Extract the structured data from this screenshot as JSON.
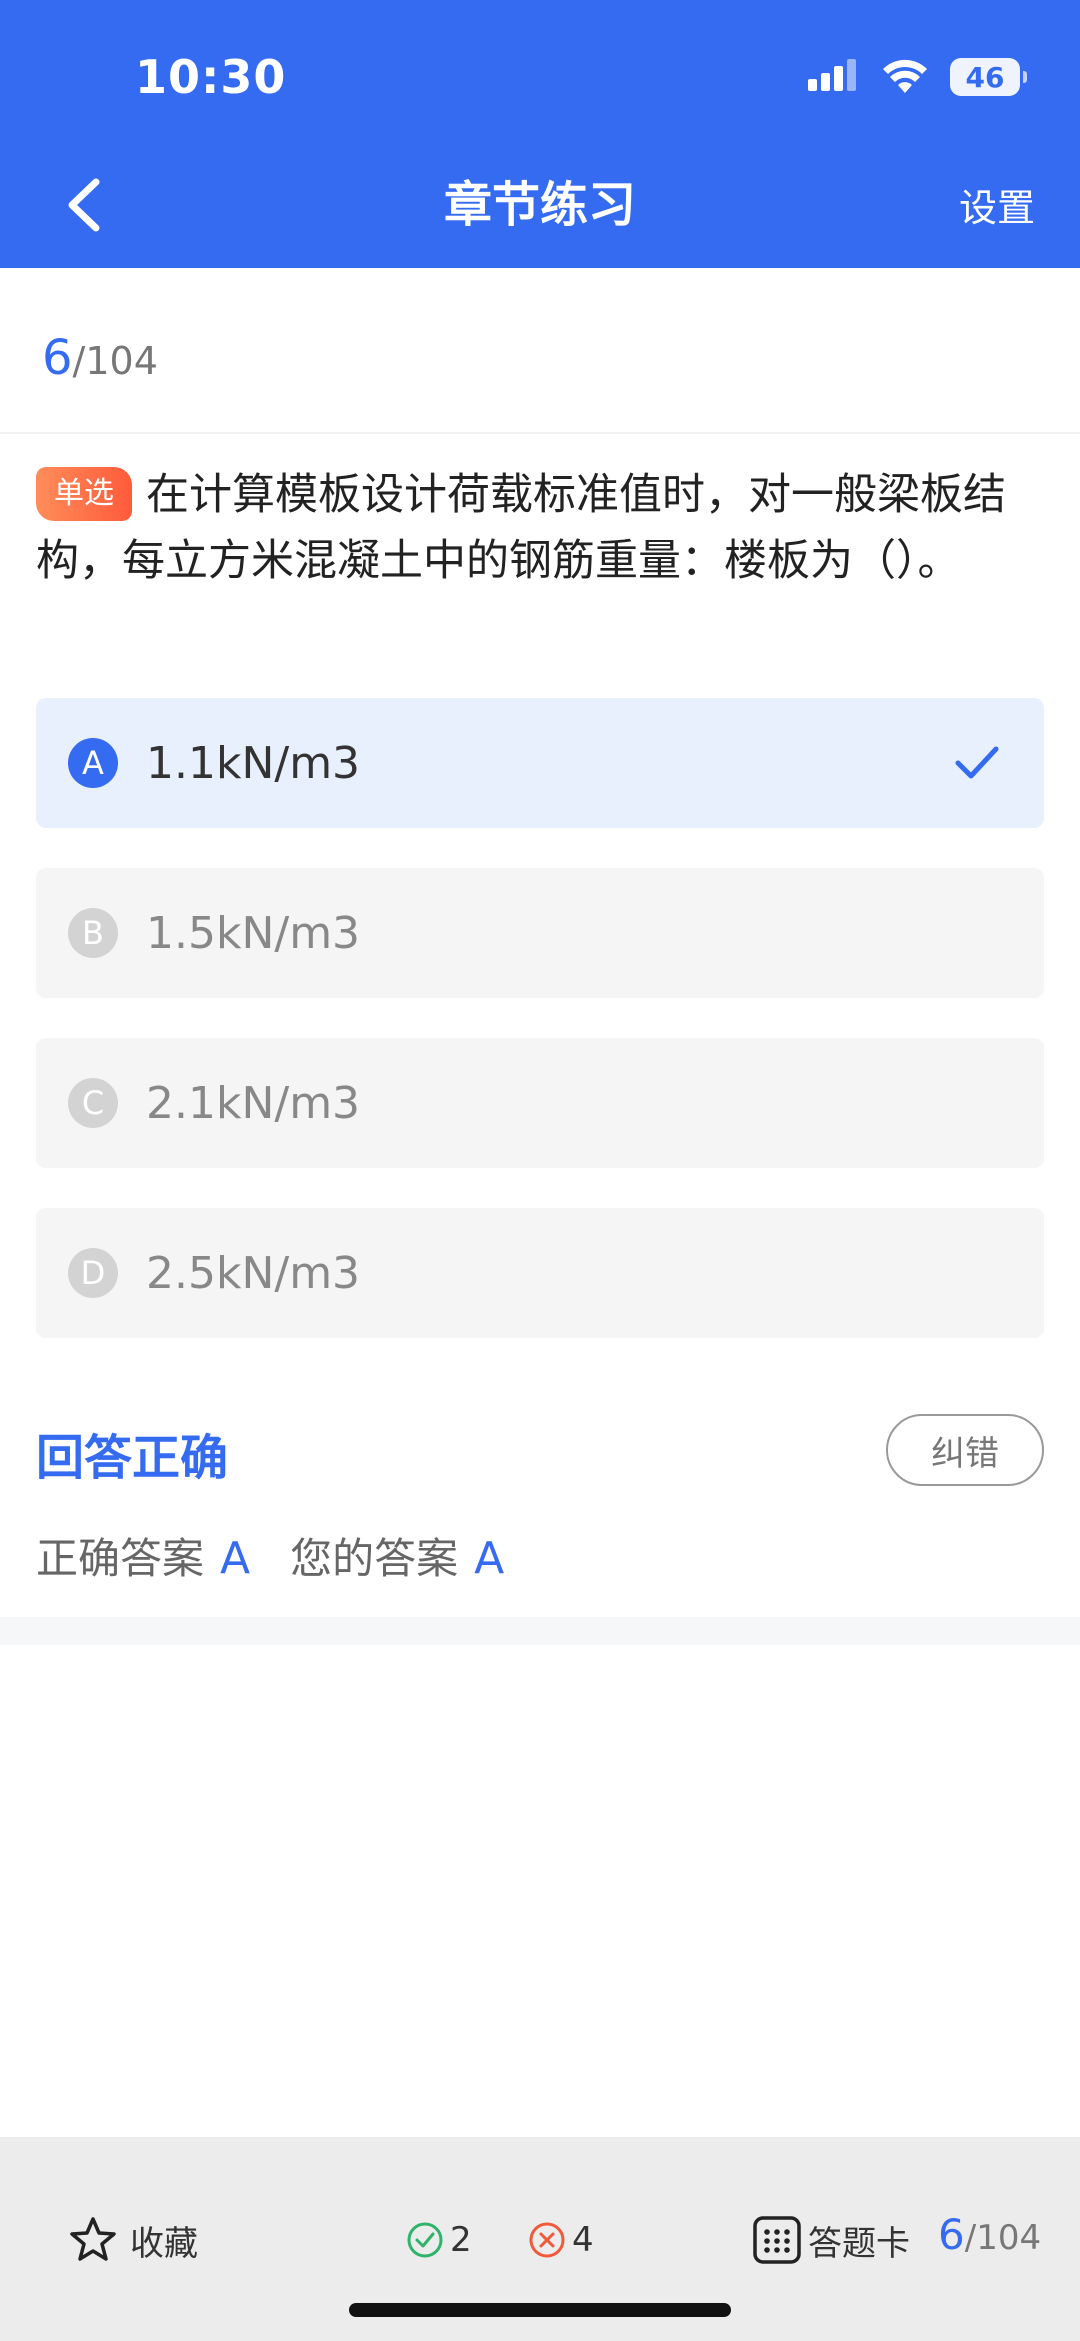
{
  "status_bar": {
    "time": "10:30",
    "battery": "46"
  },
  "nav": {
    "title": "章节练习",
    "settings_label": "设置"
  },
  "progress": {
    "current": "6",
    "total": "/104"
  },
  "question": {
    "type_tag": "单选",
    "text": "在计算模板设计荷载标准值时，对一般梁板结构，每立方米混凝土中的钢筋重量：楼板为（）。"
  },
  "options": [
    {
      "letter": "A",
      "text": "1.1kN/m3",
      "selected": true
    },
    {
      "letter": "B",
      "text": "1.5kN/m3",
      "selected": false
    },
    {
      "letter": "C",
      "text": "2.1kN/m3",
      "selected": false
    },
    {
      "letter": "D",
      "text": "2.5kN/m3",
      "selected": false
    }
  ],
  "result": {
    "title": "回答正确",
    "report_label": "纠错",
    "correct_label": "正确答案",
    "correct_value": "A",
    "your_label": "您的答案",
    "your_value": "A"
  },
  "bottom_bar": {
    "favorite_label": "收藏",
    "correct_count": "2",
    "wrong_count": "4",
    "card_label": "答题卡",
    "current": "6",
    "total": "/104"
  },
  "colors": {
    "primary": "#356BF1",
    "tag": "#ff6a45",
    "correct": "#2db36a",
    "wrong": "#f05a3a"
  }
}
